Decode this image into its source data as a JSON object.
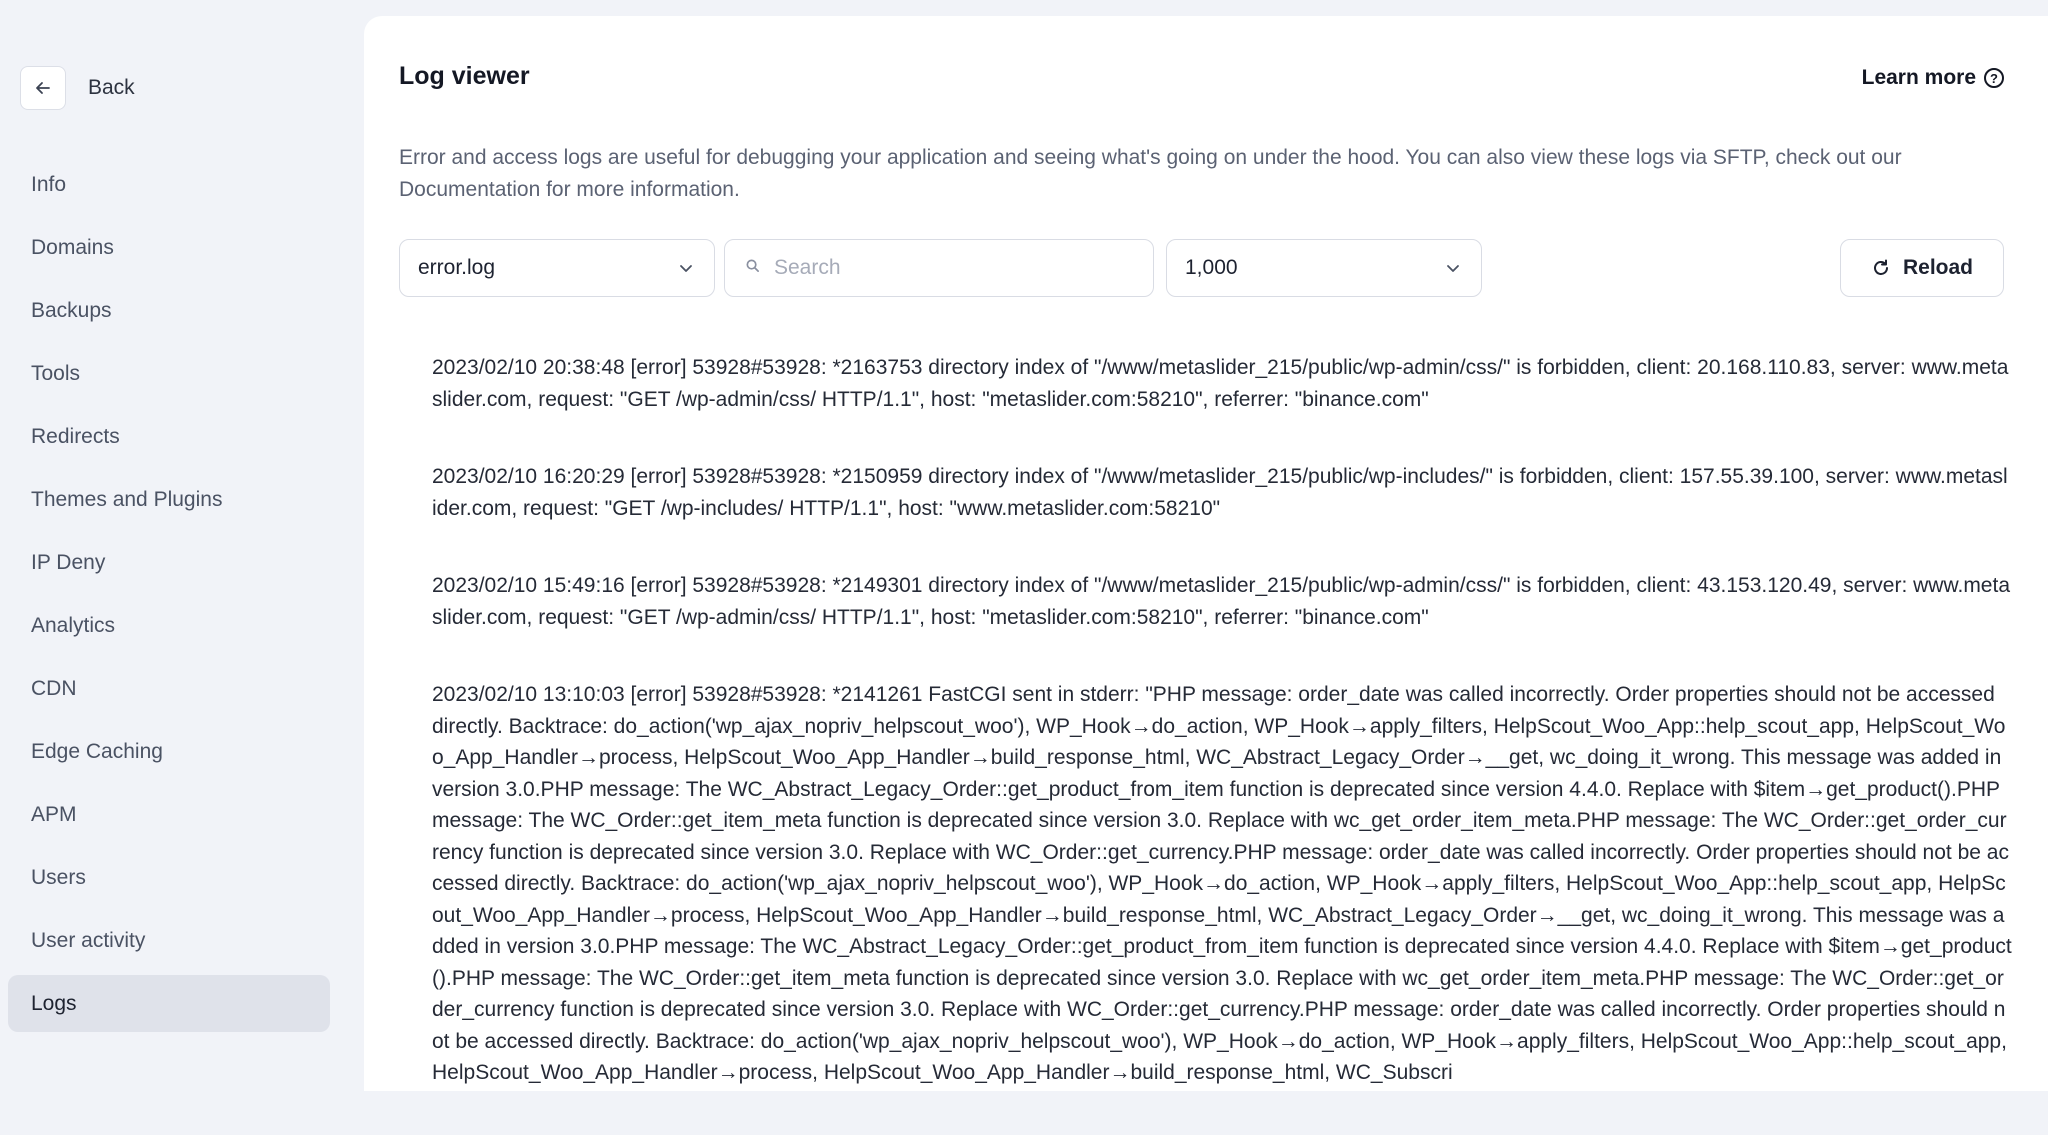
{
  "sidebar": {
    "back_label": "Back",
    "items": [
      {
        "label": "Info"
      },
      {
        "label": "Domains"
      },
      {
        "label": "Backups"
      },
      {
        "label": "Tools"
      },
      {
        "label": "Redirects"
      },
      {
        "label": "Themes and Plugins"
      },
      {
        "label": "IP Deny"
      },
      {
        "label": "Analytics"
      },
      {
        "label": "CDN"
      },
      {
        "label": "Edge Caching"
      },
      {
        "label": "APM"
      },
      {
        "label": "Users"
      },
      {
        "label": "User activity"
      },
      {
        "label": "Logs",
        "active": true
      }
    ]
  },
  "header": {
    "title": "Log viewer",
    "learn_more": "Learn more",
    "description": "Error and access logs are useful for debugging your application and seeing what's going on under the hood. You can also view these logs via SFTP, check out our Documentation for more information."
  },
  "controls": {
    "log_file": "error.log",
    "search_placeholder": "Search",
    "search_value": "",
    "line_count": "1,000",
    "reload_label": "Reload"
  },
  "logs": [
    "2023/02/10 20:38:48 [error] 53928#53928: *2163753 directory index of \"/www/metaslider_215/public/wp-admin/css/\" is forbidden, client: 20.168.110.83, server: www.metaslider.com, request: \"GET /wp-admin/css/ HTTP/1.1\", host: \"metaslider.com:58210\", referrer: \"binance.com\"",
    "2023/02/10 16:20:29 [error] 53928#53928: *2150959 directory index of \"/www/metaslider_215/public/wp-includes/\" is forbidden, client: 157.55.39.100, server: www.metaslider.com, request: \"GET /wp-includes/ HTTP/1.1\", host: \"www.metaslider.com:58210\"",
    "2023/02/10 15:49:16 [error] 53928#53928: *2149301 directory index of \"/www/metaslider_215/public/wp-admin/css/\" is forbidden, client: 43.153.120.49, server: www.metaslider.com, request: \"GET /wp-admin/css/ HTTP/1.1\", host: \"metaslider.com:58210\", referrer: \"binance.com\"",
    "2023/02/10 13:10:03 [error] 53928#53928: *2141261 FastCGI sent in stderr: \"PHP message: order_date was called incorrectly. Order properties should not be accessed directly. Backtrace: do_action('wp_ajax_nopriv_helpscout_woo'), WP_Hook→do_action, WP_Hook→apply_filters, HelpScout_Woo_App::help_scout_app, HelpScout_Woo_App_Handler→process, HelpScout_Woo_App_Handler→build_response_html, WC_Abstract_Legacy_Order→__get, wc_doing_it_wrong. This message was added in version 3.0.PHP message: The WC_Abstract_Legacy_Order::get_product_from_item function is deprecated since version 4.4.0. Replace with $item→get_product().PHP message: The WC_Order::get_item_meta function is deprecated since version 3.0. Replace with wc_get_order_item_meta.PHP message: The WC_Order::get_order_currency function is deprecated since version 3.0. Replace with WC_Order::get_currency.PHP message: order_date was called incorrectly. Order properties should not be accessed directly. Backtrace: do_action('wp_ajax_nopriv_helpscout_woo'), WP_Hook→do_action, WP_Hook→apply_filters, HelpScout_Woo_App::help_scout_app, HelpScout_Woo_App_Handler→process, HelpScout_Woo_App_Handler→build_response_html, WC_Abstract_Legacy_Order→__get, wc_doing_it_wrong. This message was added in version 3.0.PHP message: The WC_Abstract_Legacy_Order::get_product_from_item function is deprecated since version 4.4.0. Replace with $item→get_product().PHP message: The WC_Order::get_item_meta function is deprecated since version 3.0. Replace with wc_get_order_item_meta.PHP message: The WC_Order::get_order_currency function is deprecated since version 3.0. Replace with WC_Order::get_currency.PHP message: order_date was called incorrectly. Order properties should not be accessed directly. Backtrace: do_action('wp_ajax_nopriv_helpscout_woo'), WP_Hook→do_action, WP_Hook→apply_filters, HelpScout_Woo_App::help_scout_app, HelpScout_Woo_App_Handler→process, HelpScout_Woo_App_Handler→build_response_html, WC_Subscri"
  ]
}
